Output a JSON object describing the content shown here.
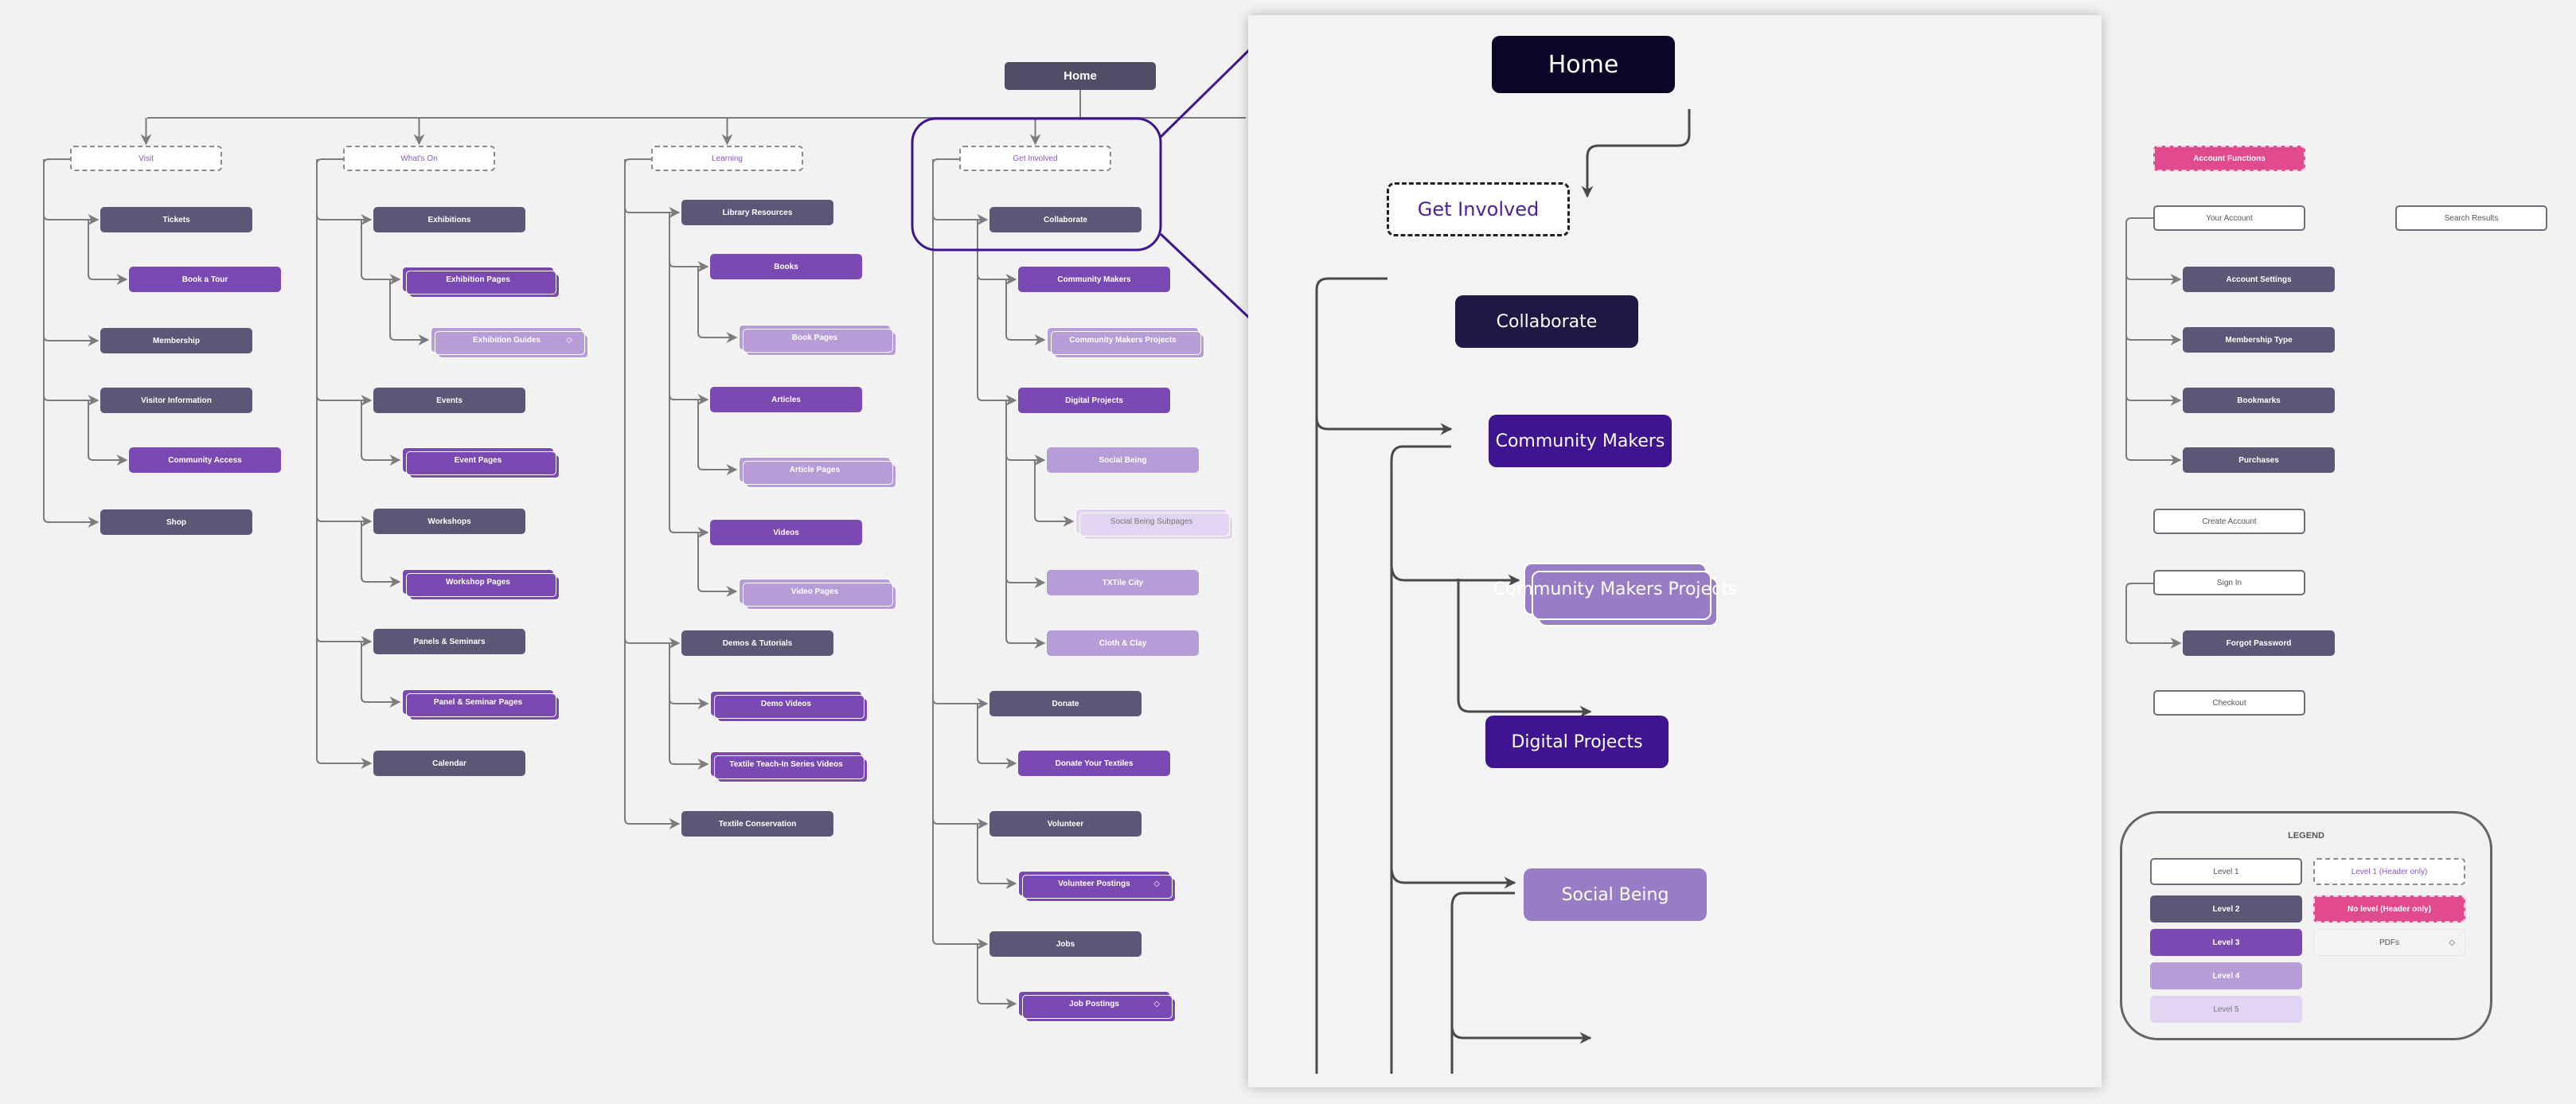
{
  "sitemap": {
    "home": "Home",
    "sections": [
      {
        "header": "Visit",
        "children": [
          {
            "label": "Tickets",
            "level": 2
          },
          {
            "label": "Book a Tour",
            "level": 3
          },
          {
            "label": "Membership",
            "level": 2
          },
          {
            "label": "Visitor Information",
            "level": 2
          },
          {
            "label": "Community Access",
            "level": 3
          },
          {
            "label": "Shop",
            "level": 2
          }
        ]
      },
      {
        "header": "What's On",
        "children": [
          {
            "label": "Exhibitions",
            "level": 2
          },
          {
            "label": "Exhibition Pages",
            "level": 3,
            "multiple": true
          },
          {
            "label": "Exhibition Guides",
            "level": 4,
            "multiple": true,
            "pdf": true
          },
          {
            "label": "Events",
            "level": 2
          },
          {
            "label": "Event Pages",
            "level": 3,
            "multiple": true
          },
          {
            "label": "Workshops",
            "level": 2
          },
          {
            "label": "Workshop Pages",
            "level": 3,
            "multiple": true
          },
          {
            "label": "Panels & Seminars",
            "level": 2
          },
          {
            "label": "Panel & Seminar Pages",
            "level": 3,
            "multiple": true
          },
          {
            "label": "Calendar",
            "level": 2
          }
        ]
      },
      {
        "header": "Learning",
        "children": [
          {
            "label": "Library Resources",
            "level": 2
          },
          {
            "label": "Books",
            "level": 3
          },
          {
            "label": "Book Pages",
            "level": 4,
            "multiple": true
          },
          {
            "label": "Articles",
            "level": 3
          },
          {
            "label": "Article Pages",
            "level": 4,
            "multiple": true
          },
          {
            "label": "Videos",
            "level": 3
          },
          {
            "label": "Video Pages",
            "level": 4,
            "multiple": true
          },
          {
            "label": "Demos & Tutorials",
            "level": 2
          },
          {
            "label": "Demo Videos",
            "level": 3,
            "multiple": true
          },
          {
            "label": "Textile Teach-In Series Videos",
            "level": 3,
            "multiple": true
          },
          {
            "label": "Textile Conservation",
            "level": 2
          }
        ]
      },
      {
        "header": "Get Involved",
        "children": [
          {
            "label": "Collaborate",
            "level": 2
          },
          {
            "label": "Community Makers",
            "level": 3
          },
          {
            "label": "Community Makers Projects",
            "level": 4,
            "multiple": true
          },
          {
            "label": "Digital Projects",
            "level": 3
          },
          {
            "label": "Social Being",
            "level": 4
          },
          {
            "label": "Social Being Subpages",
            "level": 5,
            "multiple": true
          },
          {
            "label": "TXTile City",
            "level": 4
          },
          {
            "label": "Cloth & Clay",
            "level": 4
          },
          {
            "label": "Donate",
            "level": 2
          },
          {
            "label": "Donate Your Textiles",
            "level": 3
          },
          {
            "label": "Volunteer",
            "level": 2
          },
          {
            "label": "Volunteer Postings",
            "level": 3,
            "multiple": true,
            "pdf": true
          },
          {
            "label": "Jobs",
            "level": 2
          },
          {
            "label": "Job Postings",
            "level": 3,
            "multiple": true,
            "pdf": true
          }
        ]
      }
    ],
    "account": {
      "header": "Account Functions",
      "your_account": "Your Account",
      "your_account_children": [
        "Account Settings",
        "Membership Type",
        "Bookmarks",
        "Purchases"
      ],
      "create_account": "Create Account",
      "sign_in": "Sign In",
      "forgot_password": "Forgot Password",
      "checkout": "Checkout",
      "search_results": "Search Results"
    },
    "pdf_icon": "◇"
  },
  "zoom_panel": {
    "home": "Home",
    "get_involved": "Get Involved",
    "collaborate": "Collaborate",
    "community_makers": "Community Makers",
    "community_makers_projects": "Community Makers Projects",
    "digital_projects": "Digital Projects",
    "social_being": "Social Being"
  },
  "legend": {
    "title": "LEGEND",
    "level1": "Level 1",
    "level2": "Level 2",
    "level3": "Level 3",
    "level4": "Level 4",
    "level5": "Level 5",
    "level1_header": "Level 1 (Header only)",
    "no_level_header": "No level (Header only)",
    "pdfs": "PDFs",
    "pdf_icon": "◇"
  },
  "colors": {
    "level2": "#5d5677",
    "level3": "#7a4ab2",
    "level4": "#b79dd7",
    "level5": "#e2d4f3",
    "no_level": "#e14a8c",
    "highlight": "#3e1490"
  }
}
